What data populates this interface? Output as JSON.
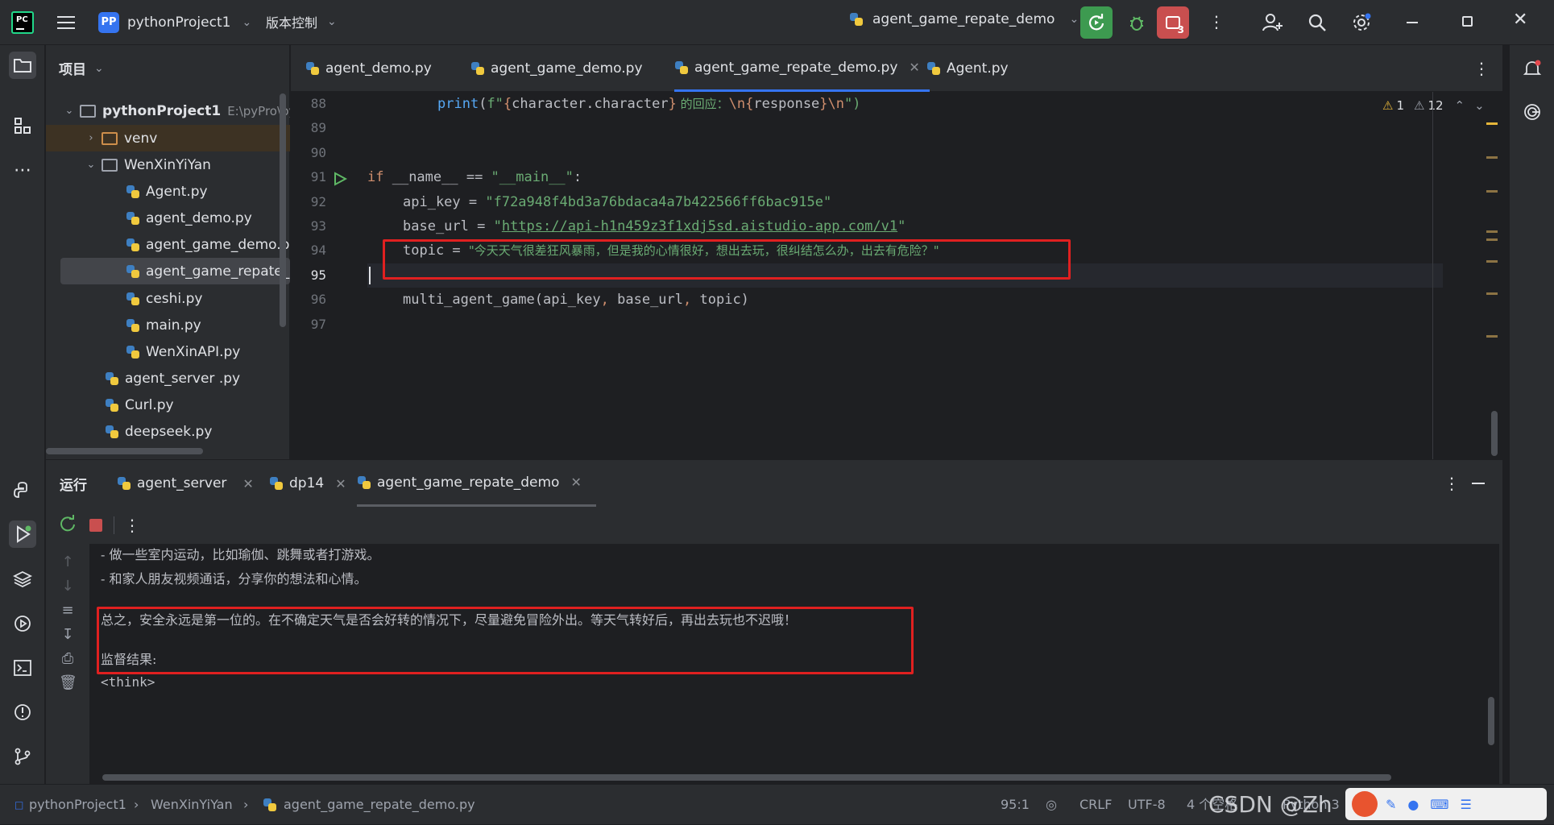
{
  "titlebar": {
    "project_badge": "PP",
    "project_name": "pythonProject1",
    "vcs_label": "版本控制",
    "run_config": "agent_game_repate_demo",
    "stop_badge": "3"
  },
  "project_panel": {
    "title": "项目",
    "items": [
      {
        "label": "pythonProject1",
        "path": "E:\\pyPro\\pyt",
        "type": "root-folder",
        "expanded": true
      },
      {
        "label": "venv",
        "type": "folder",
        "expanded": false
      },
      {
        "label": "WenXinYiYan",
        "type": "folder",
        "expanded": true
      },
      {
        "label": "Agent.py",
        "type": "py"
      },
      {
        "label": "agent_demo.py",
        "type": "py"
      },
      {
        "label": "agent_game_demo.py",
        "type": "py"
      },
      {
        "label": "agent_game_repate_de",
        "type": "py",
        "selected": true
      },
      {
        "label": "ceshi.py",
        "type": "py"
      },
      {
        "label": "main.py",
        "type": "py"
      },
      {
        "label": "WenXinAPI.py",
        "type": "py"
      },
      {
        "label": "agent_server .py",
        "type": "py"
      },
      {
        "label": "Curl.py",
        "type": "py"
      },
      {
        "label": "deepseek.py",
        "type": "py"
      }
    ]
  },
  "editor": {
    "tabs": [
      {
        "label": "agent_demo.py",
        "active": false
      },
      {
        "label": "agent_game_demo.py",
        "active": false
      },
      {
        "label": "agent_game_repate_demo.py",
        "active": true
      },
      {
        "label": "Agent.py",
        "active": false
      }
    ],
    "inspections": {
      "warnings": "1",
      "weak_warnings": "12"
    },
    "line_numbers": [
      "88",
      "89",
      "90",
      "91",
      "92",
      "93",
      "94",
      "95",
      "96",
      "97"
    ],
    "code": {
      "l88_print": "print",
      "l88_a": "(",
      "l88_f": "f\"",
      "l88_b1": "{",
      "l88_expr": "character.character",
      "l88_b2": "}",
      "l88_text": " 的回应：",
      "l88_nl": "\\n",
      "l88_b3": "{",
      "l88_resp": "response",
      "l88_b4": "}",
      "l88_nl2": "\\n",
      "l88_end": "\")",
      "l91_if": "if",
      "l91_name": " __name__ == ",
      "l91_main": "\"__main__\"",
      "l91_colon": ":",
      "l92_var": "api_key = ",
      "l92_val": "\"f72a948f4bd3a76bdaca4a7b422566ff6bac915e\"",
      "l93_var": "base_url = ",
      "l93_q1": "\"",
      "l93_url": "https://api-h1n459z3f1xdj5sd.aistudio-app.com/v1",
      "l93_q2": "\"",
      "l94_var": "topic = ",
      "l94_val": "\"今天天气很差狂风暴雨，但是我的心情很好，想出去玩，很纠结怎么办，出去有危险？\"",
      "l96_call": "multi_agent_game(api_key",
      "l96_c1": ", ",
      "l96_p2": "base_url",
      "l96_c2": ", ",
      "l96_p3": "topic)"
    }
  },
  "run_panel": {
    "title": "运行",
    "tabs": [
      {
        "label": "agent_server",
        "active": false
      },
      {
        "label": "dp14",
        "active": false
      },
      {
        "label": "agent_game_repate_demo",
        "active": true
      }
    ],
    "console_lines": [
      "- 做一些室内运动，比如瑜伽、跳舞或者打游戏。",
      "- 和家人朋友视频通话，分享你的想法和心情。",
      "总之，安全永远是第一位的。在不确定天气是否会好转的情况下，尽量避免冒险外出。等天气转好后，再出去玩也不迟哦！",
      "监督结果:",
      "<think>"
    ]
  },
  "statusbar": {
    "crumb_project": "pythonProject1",
    "crumb_folder": "WenXinYiYan",
    "crumb_file": "agent_game_repate_demo.py",
    "caret": "95:1",
    "line_sep": "CRLF",
    "encoding": "UTF-8",
    "indent": "4 个空格",
    "interpreter": "Python 3",
    "watermark": "CSDN @Zh"
  },
  "colors": {
    "accent": "#3574f0",
    "highlight_box": "#e02020",
    "run_green": "#3d9a50",
    "stop_red": "#c94f4f"
  }
}
